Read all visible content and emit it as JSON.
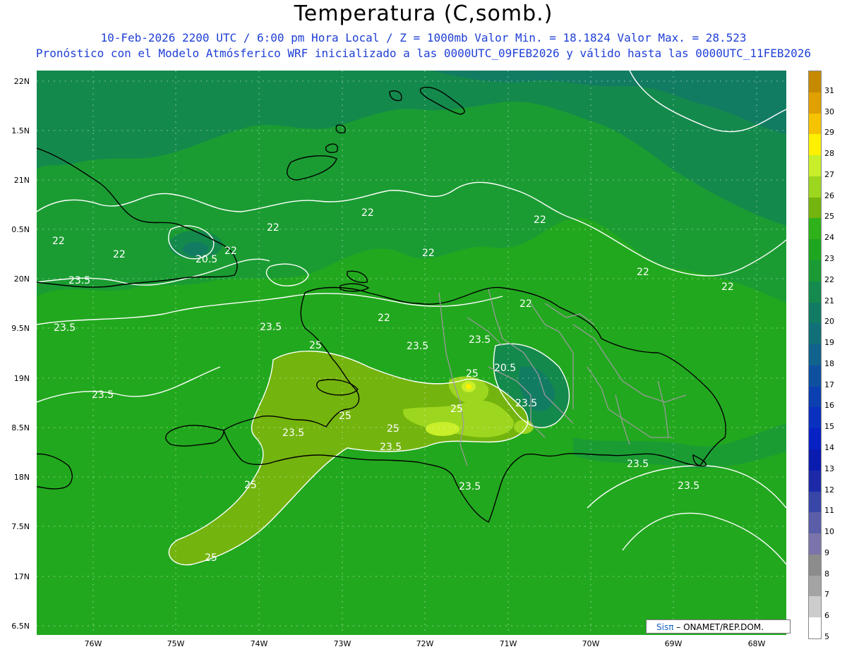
{
  "header": {
    "title": "Temperatura (C,somb.)",
    "subtitle1": "10-Feb-2026  2200 UTC / 6:00 pm Hora Local / Z = 1000mb    Valor Min. = 18.1824  Valor Max. = 28.523",
    "subtitle2": "Pronóstico con el Modelo Atmósferico WRF inicializado a las 0000UTC_09FEB2026 y válido hasta las  0000UTC_11FEB2026"
  },
  "axes": {
    "lat_labels": [
      "22N",
      "1.5N",
      "21N",
      "0.5N",
      "20N",
      "9.5N",
      "19N",
      "8.5N",
      "18N",
      "7.5N",
      "17N",
      "6.5N"
    ],
    "lon_labels": [
      "76W",
      "75W",
      "74W",
      "73W",
      "72W",
      "71W",
      "70W",
      "69W",
      "68W"
    ]
  },
  "contour_labels": [
    "22",
    "22",
    "22",
    "22",
    "22",
    "22",
    "22",
    "22",
    "22",
    "22",
    "22",
    "20.5",
    "20.5",
    "23.5",
    "23.5",
    "23.5",
    "23.5",
    "23.5",
    "23.5",
    "23.5",
    "23.5",
    "23.5",
    "23.5",
    "23.5",
    "23.5",
    "25",
    "25",
    "25",
    "25",
    "25",
    "25",
    "25"
  ],
  "colorbar": {
    "labels": [
      "31",
      "30",
      "29",
      "28",
      "27",
      "26",
      "25",
      "24",
      "23",
      "22",
      "21",
      "20",
      "19",
      "18",
      "17",
      "16",
      "15",
      "14",
      "13",
      "12",
      "11",
      "10",
      "9",
      "8",
      "7",
      "6",
      "5"
    ],
    "colors": [
      "#c58a00",
      "#e0a000",
      "#f5c300",
      "#fff000",
      "#c8ef2a",
      "#9dd61f",
      "#74b40e",
      "#2fb11a",
      "#1ea621",
      "#199a35",
      "#148a4f",
      "#127b63",
      "#116f78",
      "#11628c",
      "#0f4fa0",
      "#0c3fb0",
      "#0a30bf",
      "#0821c4",
      "#0a1bb0",
      "#1d2aa8",
      "#3846a8",
      "#5a5ea8",
      "#7a74aa",
      "#8c8c8c",
      "#a4a4a4",
      "#cccccc",
      "#ffffff"
    ]
  },
  "credit": {
    "brand": "Sisπ",
    "text": "– ONAMET/REP.DOM."
  }
}
